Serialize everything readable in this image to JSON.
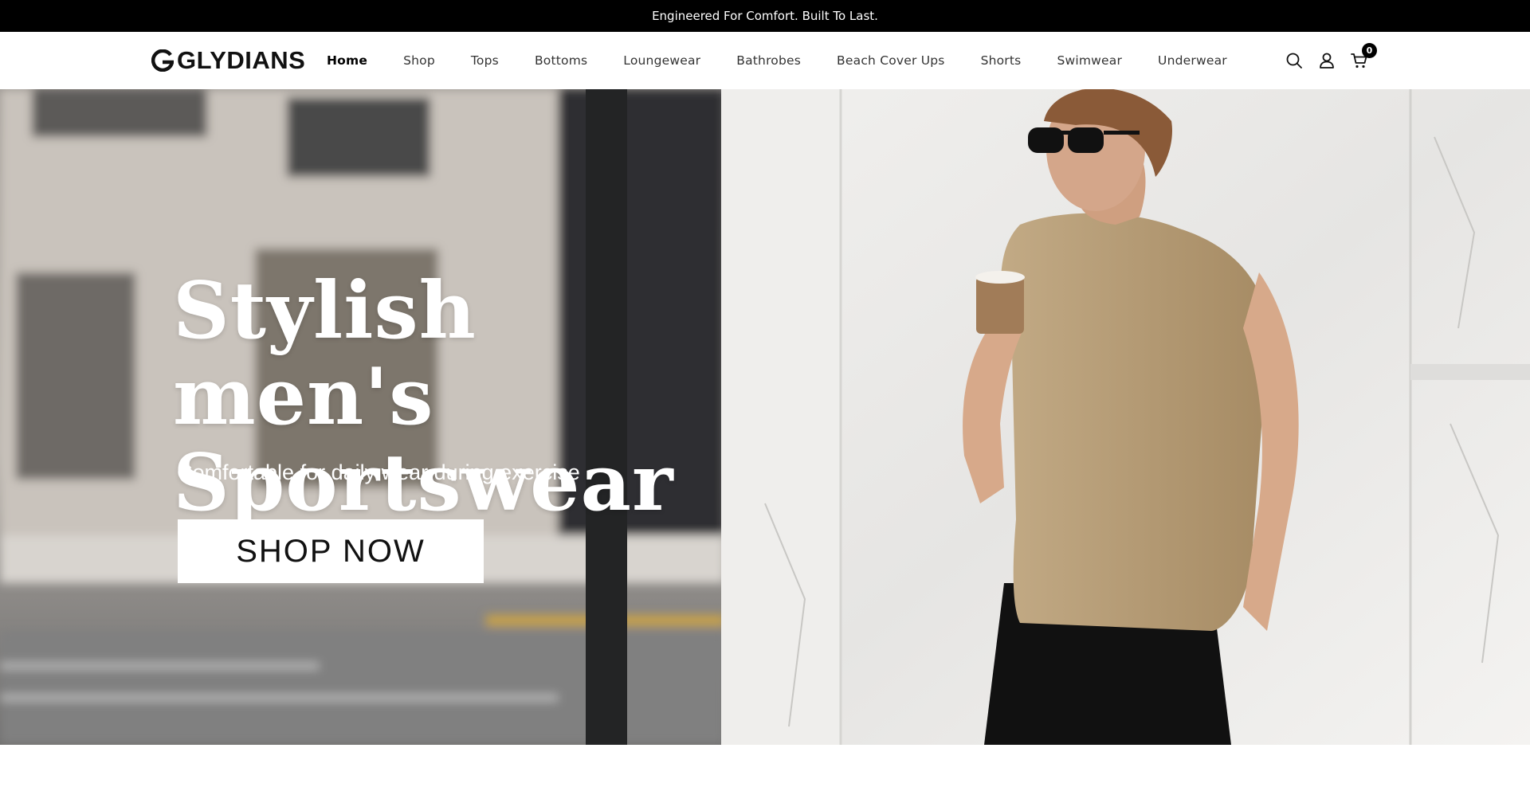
{
  "announcement": "Engineered For Comfort. Built To Last.",
  "brand": {
    "name": "GLYDIANS"
  },
  "nav": [
    {
      "label": "Home",
      "active": true
    },
    {
      "label": "Shop"
    },
    {
      "label": "Tops"
    },
    {
      "label": "Bottoms"
    },
    {
      "label": "Loungewear"
    },
    {
      "label": "Bathrobes"
    },
    {
      "label": "Beach Cover Ups"
    },
    {
      "label": "Shorts"
    },
    {
      "label": "Swimwear"
    },
    {
      "label": "Underwear"
    }
  ],
  "header_icons": {
    "search": "search-icon",
    "account": "user-icon",
    "cart": "cart-icon",
    "cart_count": "0"
  },
  "hero": {
    "title_line1": "Stylish men's",
    "title_line2": "Sportswear",
    "subtitle": "Comfortable for daily wear during exercise",
    "cta_label": "SHOP NOW"
  },
  "colors": {
    "announcement_bg": "#000000",
    "accent": "#000000",
    "shirt": "#b9a07a",
    "marble": "#ececea"
  }
}
